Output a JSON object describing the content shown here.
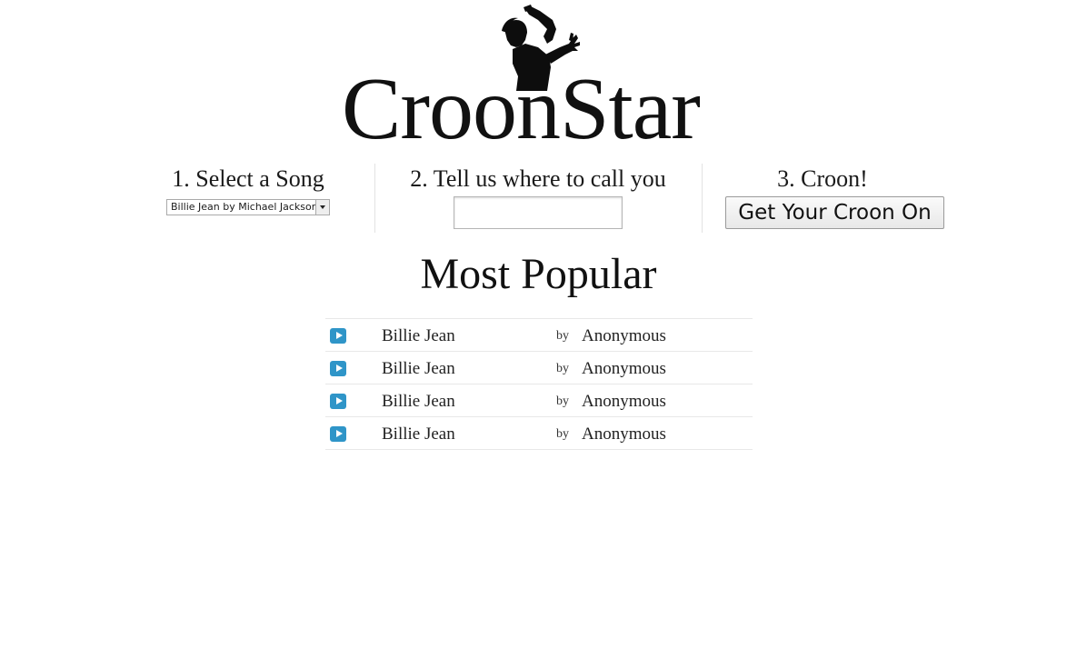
{
  "header": {
    "logo_text": "CroonStar",
    "logo_figure_icon": "crooner-silhouette-icon"
  },
  "steps": {
    "step1": {
      "title": "1. Select a Song",
      "selected_song": "Billie Jean by Michael Jackson"
    },
    "step2": {
      "title": "2. Tell us where to call you",
      "phone_value": "",
      "phone_placeholder": ""
    },
    "step3": {
      "title": "3. Croon!",
      "button_label": "Get Your Croon On"
    }
  },
  "popular": {
    "title": "Most Popular",
    "items": [
      {
        "song": "Billie Jean",
        "by": "by",
        "artist": "Anonymous"
      },
      {
        "song": "Billie Jean",
        "by": "by",
        "artist": "Anonymous"
      },
      {
        "song": "Billie Jean",
        "by": "by",
        "artist": "Anonymous"
      },
      {
        "song": "Billie Jean",
        "by": "by",
        "artist": "Anonymous"
      }
    ]
  },
  "colors": {
    "play_button": "#2f95c8",
    "text": "#1a1a1a",
    "divider": "#e2e2e2"
  },
  "icons": {
    "play": "play-icon",
    "dropdown": "chevron-down-icon"
  }
}
